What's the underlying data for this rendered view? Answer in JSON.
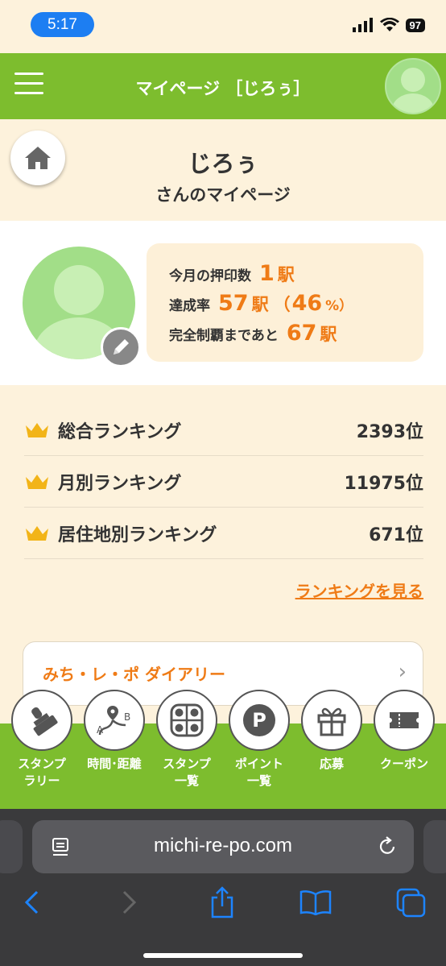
{
  "status_bar": {
    "time": "5:17",
    "battery": "97"
  },
  "header": {
    "title": "マイページ ［じろぅ］"
  },
  "user": {
    "name": "じろぅ",
    "subtitle": "さんのマイページ"
  },
  "stats": {
    "month_label": "今月の押印数",
    "month_count": "1",
    "station_unit": "駅",
    "rate_label": "達成率",
    "rate_count": "57",
    "rate_open": "（",
    "rate_percent": "46",
    "rate_close": "%）",
    "remaining_label": "完全制覇まであと",
    "remaining_count": "67"
  },
  "rankings": [
    {
      "label": "総合ランキング",
      "value": "2393位"
    },
    {
      "label": "月別ランキング",
      "value": "11975位"
    },
    {
      "label": "居住地別ランキング",
      "value": "671位"
    }
  ],
  "ranking_link": "ランキングを見る",
  "diary": {
    "label": "みち・レ・ポ ダイアリー"
  },
  "nav": [
    {
      "label": "スタンプ\nラリー",
      "icon": "stamp-icon"
    },
    {
      "label": "時間･距離",
      "icon": "route-icon"
    },
    {
      "label": "スタンプ\n一覧",
      "icon": "grid-icon"
    },
    {
      "label": "ポイント\n一覧",
      "icon": "point-icon"
    },
    {
      "label": "応募",
      "icon": "gift-icon"
    },
    {
      "label": "クーポン",
      "icon": "coupon-icon"
    }
  ],
  "browser": {
    "url": "michi-re-po.com"
  },
  "colors": {
    "accent": "#7dbd2e",
    "highlight": "#ef7b16",
    "background": "#fdf2dc"
  }
}
